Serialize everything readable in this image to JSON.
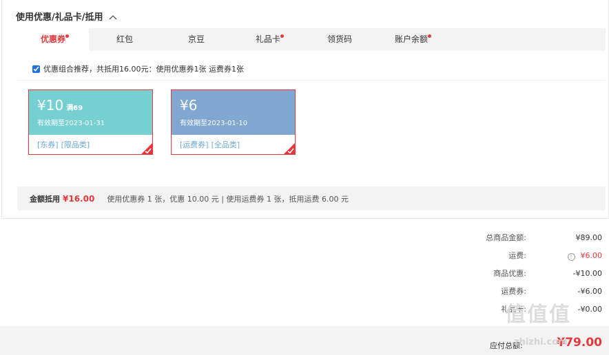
{
  "section": {
    "title": "使用优惠/礼品卡/抵用"
  },
  "tabs": [
    {
      "label": "优惠券",
      "dot": true
    },
    {
      "label": "红包",
      "dot": false
    },
    {
      "label": "京豆",
      "dot": false
    },
    {
      "label": "礼品卡",
      "dot": true
    },
    {
      "label": "领货码",
      "dot": false
    },
    {
      "label": "账户余额",
      "dot": true
    }
  ],
  "recommend": {
    "checked": true,
    "text": "优惠组合推荐，共抵用16.00元：使用优惠券1张 运费券1张"
  },
  "coupons": [
    {
      "amount": "¥10",
      "condition": "满69",
      "valid": "有效期至2023-01-31",
      "tags": [
        "[东券]",
        "[限品类]"
      ],
      "color": "#76d0d2"
    },
    {
      "amount": "¥6",
      "condition": "",
      "valid": "有效期至2023-01-10",
      "tags": [
        "[运费券]",
        "[全品类]"
      ],
      "color": "#7fa7cf"
    }
  ],
  "summary": {
    "label": "金额抵用",
    "amount": "¥16.00",
    "desc": "使用优惠券 1 张，优惠 10.00 元  | 使用运费券 1 张，抵用运费 6.00 元"
  },
  "totals": [
    {
      "label": "总商品金额:",
      "value": "¥89.00",
      "highlight": false,
      "info": false
    },
    {
      "label": "运费:",
      "value": "¥6.00",
      "highlight": true,
      "info": true
    },
    {
      "label": "商品优惠:",
      "value": "-¥10.00",
      "highlight": false,
      "info": false
    },
    {
      "label": "运费券:",
      "value": "-¥6.00",
      "highlight": false,
      "info": false
    },
    {
      "label": "礼品卡:",
      "value": "-¥0.00",
      "highlight": false,
      "info": false
    }
  ],
  "pay": {
    "label": "应付总额:",
    "value": "¥79.00"
  },
  "watermark": {
    "logo": "值值值",
    "text": "zhizhi.com"
  },
  "colors": {
    "accent": "#e4393c",
    "tab_bg": "#f3f3f3"
  }
}
